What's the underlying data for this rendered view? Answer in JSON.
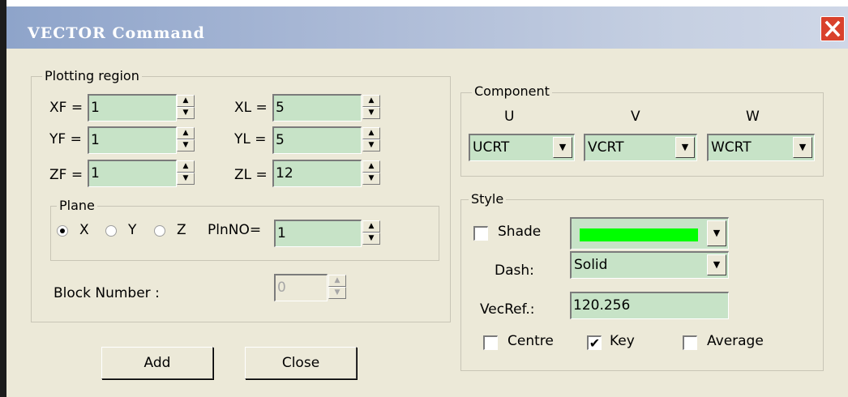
{
  "window": {
    "title": "VECTOR Command",
    "close_glyph": "✕"
  },
  "plotting_region": {
    "legend": "Plotting region",
    "xf": {
      "label": "XF =",
      "value": "1"
    },
    "yf": {
      "label": "YF =",
      "value": "1"
    },
    "zf": {
      "label": "ZF =",
      "value": "1"
    },
    "xl": {
      "label": "XL =",
      "value": "5"
    },
    "yl": {
      "label": "YL =",
      "value": "5"
    },
    "zl": {
      "label": "ZL =",
      "value": "12"
    },
    "plane": {
      "legend": "Plane",
      "options": [
        "X",
        "Y",
        "Z"
      ],
      "selected": "X",
      "plnno_label": "PlnNO=",
      "plnno_value": "1"
    },
    "block_number": {
      "label": "Block Number :",
      "value": "0"
    }
  },
  "component": {
    "legend": "Component",
    "u": {
      "header": "U",
      "value": "UCRT"
    },
    "v": {
      "header": "V",
      "value": "VCRT"
    },
    "w": {
      "header": "W",
      "value": "WCRT"
    }
  },
  "style": {
    "legend": "Style",
    "shade": {
      "label": "Shade",
      "checked": false,
      "color": "#00ff00"
    },
    "dash": {
      "label": "Dash:",
      "value": "Solid"
    },
    "vecref": {
      "label": "VecRef.:",
      "value": "120.256"
    },
    "centre": {
      "label": "Centre",
      "checked": false
    },
    "key": {
      "label": "Key",
      "checked": true,
      "mark": "✔"
    },
    "average": {
      "label": "Average",
      "checked": false
    }
  },
  "buttons": {
    "add": "Add",
    "close": "Close"
  },
  "glyphs": {
    "spin_up": "▲",
    "spin_down": "▼",
    "combo_arrow": "▼"
  }
}
